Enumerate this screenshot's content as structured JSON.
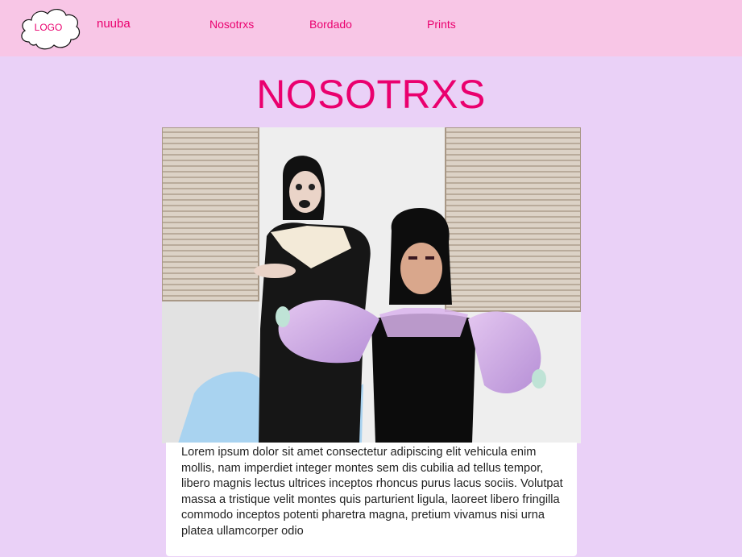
{
  "header": {
    "logo_text": "LOGO",
    "brand": "nuuba",
    "nav": [
      {
        "label": "Nosotrxs"
      },
      {
        "label": "Bordado"
      },
      {
        "label": "Prints"
      }
    ]
  },
  "main": {
    "title": "NOSOTRXS",
    "photo_alt": "Two people posing in front of window blinds",
    "body": "Lorem ipsum dolor sit amet consectetur adipiscing elit vehicula enim mollis, nam imperdiet integer montes sem dis cubilia ad tellus tempor, libero magnis lectus ultrices inceptos rhoncus purus lacus sociis. Volutpat massa a tristique velit montes quis parturient ligula, laoreet libero fringilla commodo inceptos potenti pharetra magna, pretium vivamus nisi urna platea ullamcorper odio"
  },
  "colors": {
    "page_background": "#ead1f7",
    "header_background": "#f8c6e6",
    "accent": "#ea006e"
  }
}
